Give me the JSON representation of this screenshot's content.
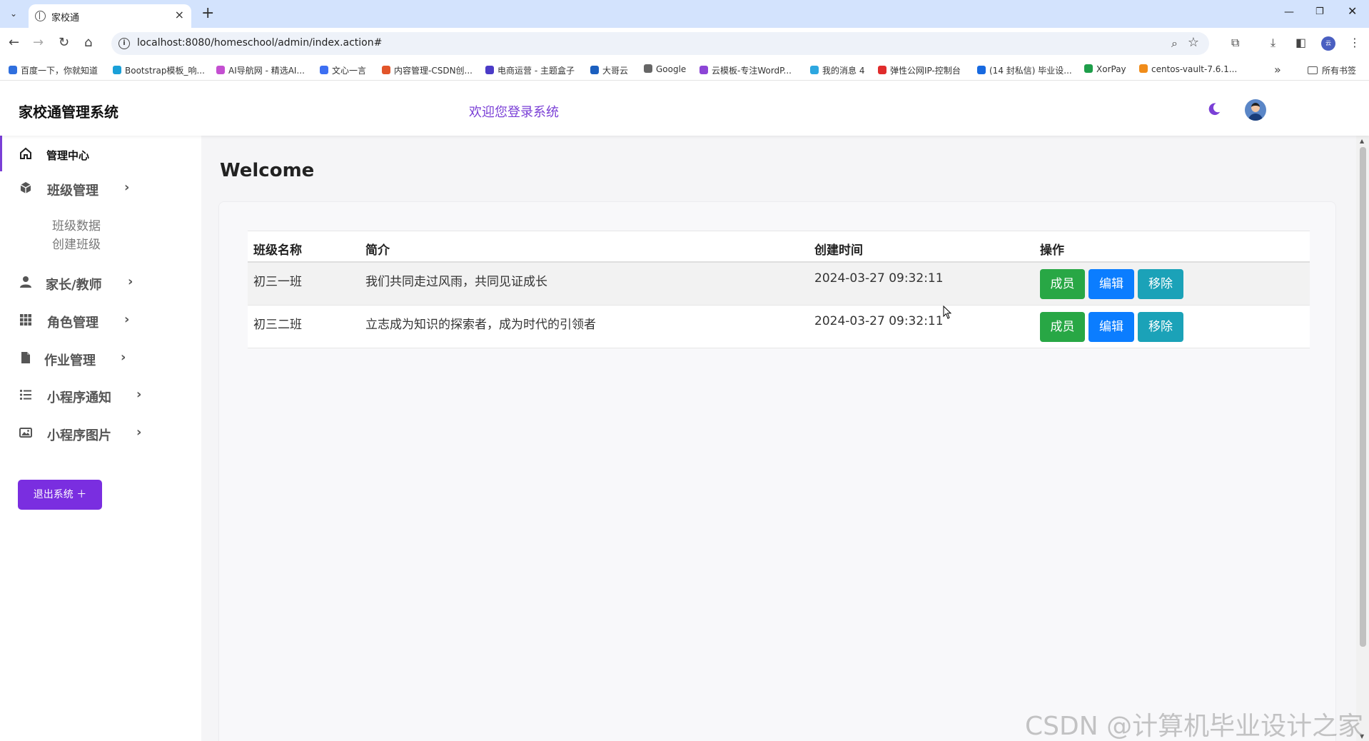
{
  "browser": {
    "tab_title": "家校通",
    "url": "localhost:8080/homeschool/admin/index.action#",
    "bookmarks": [
      {
        "label": "百度一下，你就知道",
        "color": "#2f6fde"
      },
      {
        "label": "Bootstrap模板_响...",
        "color": "#1aa0d8"
      },
      {
        "label": "AI导航网 - 精选AI...",
        "color": "#c44fd1"
      },
      {
        "label": "文心一言",
        "color": "#3d6ff2"
      },
      {
        "label": "内容管理-CSDN创...",
        "color": "#e2552a"
      },
      {
        "label": "电商运营 - 主题盒子",
        "color": "#4b3bc7"
      },
      {
        "label": "大哥云",
        "color": "#1b5fbf"
      },
      {
        "label": "Google",
        "color": "#666666"
      },
      {
        "label": "云模板-专注WordP...",
        "color": "#8c45d6"
      },
      {
        "label": "我的消息 4",
        "color": "#2da7e0"
      },
      {
        "label": "弹性公网IP-控制台",
        "color": "#e02c2c"
      },
      {
        "label": "(14 封私信) 毕业设...",
        "color": "#1769e0"
      },
      {
        "label": "XorPay",
        "color": "#1e9e4a"
      },
      {
        "label": "centos-vault-7.6.1...",
        "color": "#f08c1a"
      }
    ],
    "all_bookmarks_label": "所有书签"
  },
  "header": {
    "brand": "家校通管理系统",
    "welcome": "欢迎您登录系统",
    "accent_color": "#7a3fd6"
  },
  "sidebar": {
    "items": [
      {
        "label": "管理中心",
        "icon": "home-icon"
      },
      {
        "label": "班级管理",
        "icon": "cube-icon"
      },
      {
        "label": "家长/教师",
        "icon": "user-icon"
      },
      {
        "label": "角色管理",
        "icon": "grid-icon"
      },
      {
        "label": "作业管理",
        "icon": "file-icon"
      },
      {
        "label": "小程序通知",
        "icon": "list-icon"
      },
      {
        "label": "小程序图片",
        "icon": "image-icon"
      }
    ],
    "class_submenu": [
      "班级数据",
      "创建班级"
    ],
    "logout_label": "退出系统 ＋"
  },
  "main": {
    "title": "Welcome",
    "table": {
      "headers": [
        "班级名称",
        "简介",
        "创建时间",
        "操作"
      ],
      "rows": [
        {
          "name": "初三一班",
          "intro": "我们共同走过风雨，共同见证成长",
          "created": "2024-03-27 09:32:11"
        },
        {
          "name": "初三二班",
          "intro": "立志成为知识的探索者，成为时代的引领者",
          "created": "2024-03-27 09:32:11"
        }
      ],
      "actions": {
        "members": "成员",
        "edit": "编辑",
        "remove": "移除"
      }
    }
  },
  "watermark": "CSDN @计算机毕业设计之家"
}
